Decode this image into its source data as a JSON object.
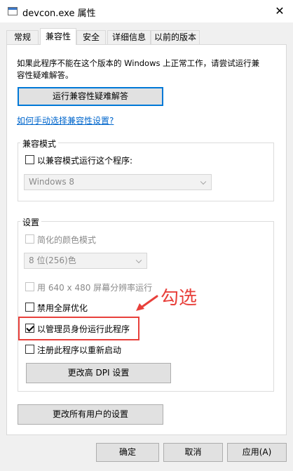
{
  "window": {
    "title": "devcon.exe 属性"
  },
  "tabs": [
    {
      "label": "常规"
    },
    {
      "label": "兼容性"
    },
    {
      "label": "安全"
    },
    {
      "label": "详细信息"
    },
    {
      "label": "以前的版本"
    }
  ],
  "intro": {
    "line1": "如果此程序不能在这个版本的 Windows 上正常工作，请尝试运行兼",
    "line2": "容性疑难解答。"
  },
  "troubleshoot_button": "运行兼容性疑难解答",
  "manual_link": "如何手动选择兼容性设置?",
  "compat_mode": {
    "group_label": "兼容模式",
    "checkbox_label": "以兼容模式运行这个程序:",
    "checked": false,
    "select_value": "Windows 8"
  },
  "settings": {
    "group_label": "设置",
    "reduced_color": {
      "label": "简化的颜色模式",
      "checked": false
    },
    "color_select_value": "8 位(256)色",
    "res_640": {
      "label": "用 640 x 480 屏幕分辨率运行",
      "checked": false
    },
    "disable_fullscreen": {
      "label": "禁用全屏优化",
      "checked": false
    },
    "run_as_admin": {
      "label": "以管理员身份运行此程序",
      "checked": true
    },
    "register_restart": {
      "label": "注册此程序以重新启动",
      "checked": false
    },
    "dpi_button": "更改高 DPI 设置"
  },
  "all_users_button": "更改所有用户的设置",
  "annotation": {
    "text": "勾选",
    "color": "#e8403b"
  },
  "bottom_buttons": {
    "ok": "确定",
    "cancel": "取消",
    "apply": "应用(A)"
  },
  "colors": {
    "accent": "#0078d7",
    "link": "#0066cc",
    "annotation": "#e8403b"
  }
}
